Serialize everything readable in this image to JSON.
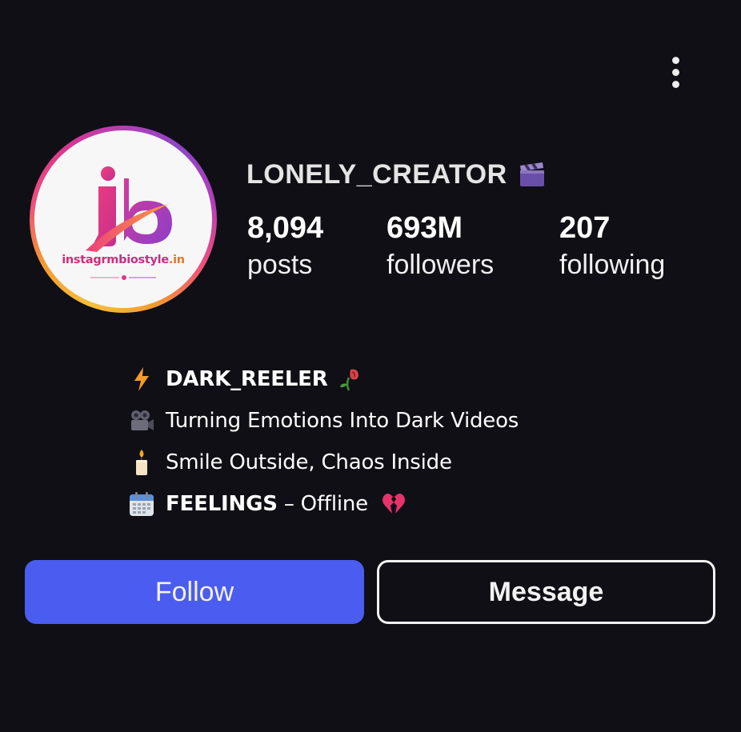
{
  "profile": {
    "username": "LONELY_CREATOR",
    "username_icon": "clapper-board-icon",
    "avatar": {
      "logo_text_pink": "instagrm",
      "logo_text_purple": "biostyle",
      "logo_text_suffix": ".in",
      "logo_letters": "iB"
    }
  },
  "stats": [
    {
      "value": "8,094",
      "label": "posts"
    },
    {
      "value": "693M",
      "label": "followers"
    },
    {
      "value": "207",
      "label": "following"
    }
  ],
  "bio": [
    {
      "icon": "lightning-icon",
      "text": "DARK_REELER",
      "bold": true,
      "trail_icon": "wilted-rose-icon"
    },
    {
      "icon": "movie-camera-icon",
      "text": "Turning Emotions Into Dark Videos"
    },
    {
      "icon": "candle-icon",
      "text": "Smile Outside, Chaos Inside"
    },
    {
      "icon": "calendar-icon",
      "bold_part": "FEELINGS",
      "rest": " – Offline",
      "trail_icon": "broken-heart-icon"
    }
  ],
  "actions": {
    "follow_label": "Follow",
    "message_label": "Message"
  },
  "colors": {
    "background": "#0f0f15",
    "follow_button": "#4b5cf0",
    "text": "#ffffff"
  }
}
